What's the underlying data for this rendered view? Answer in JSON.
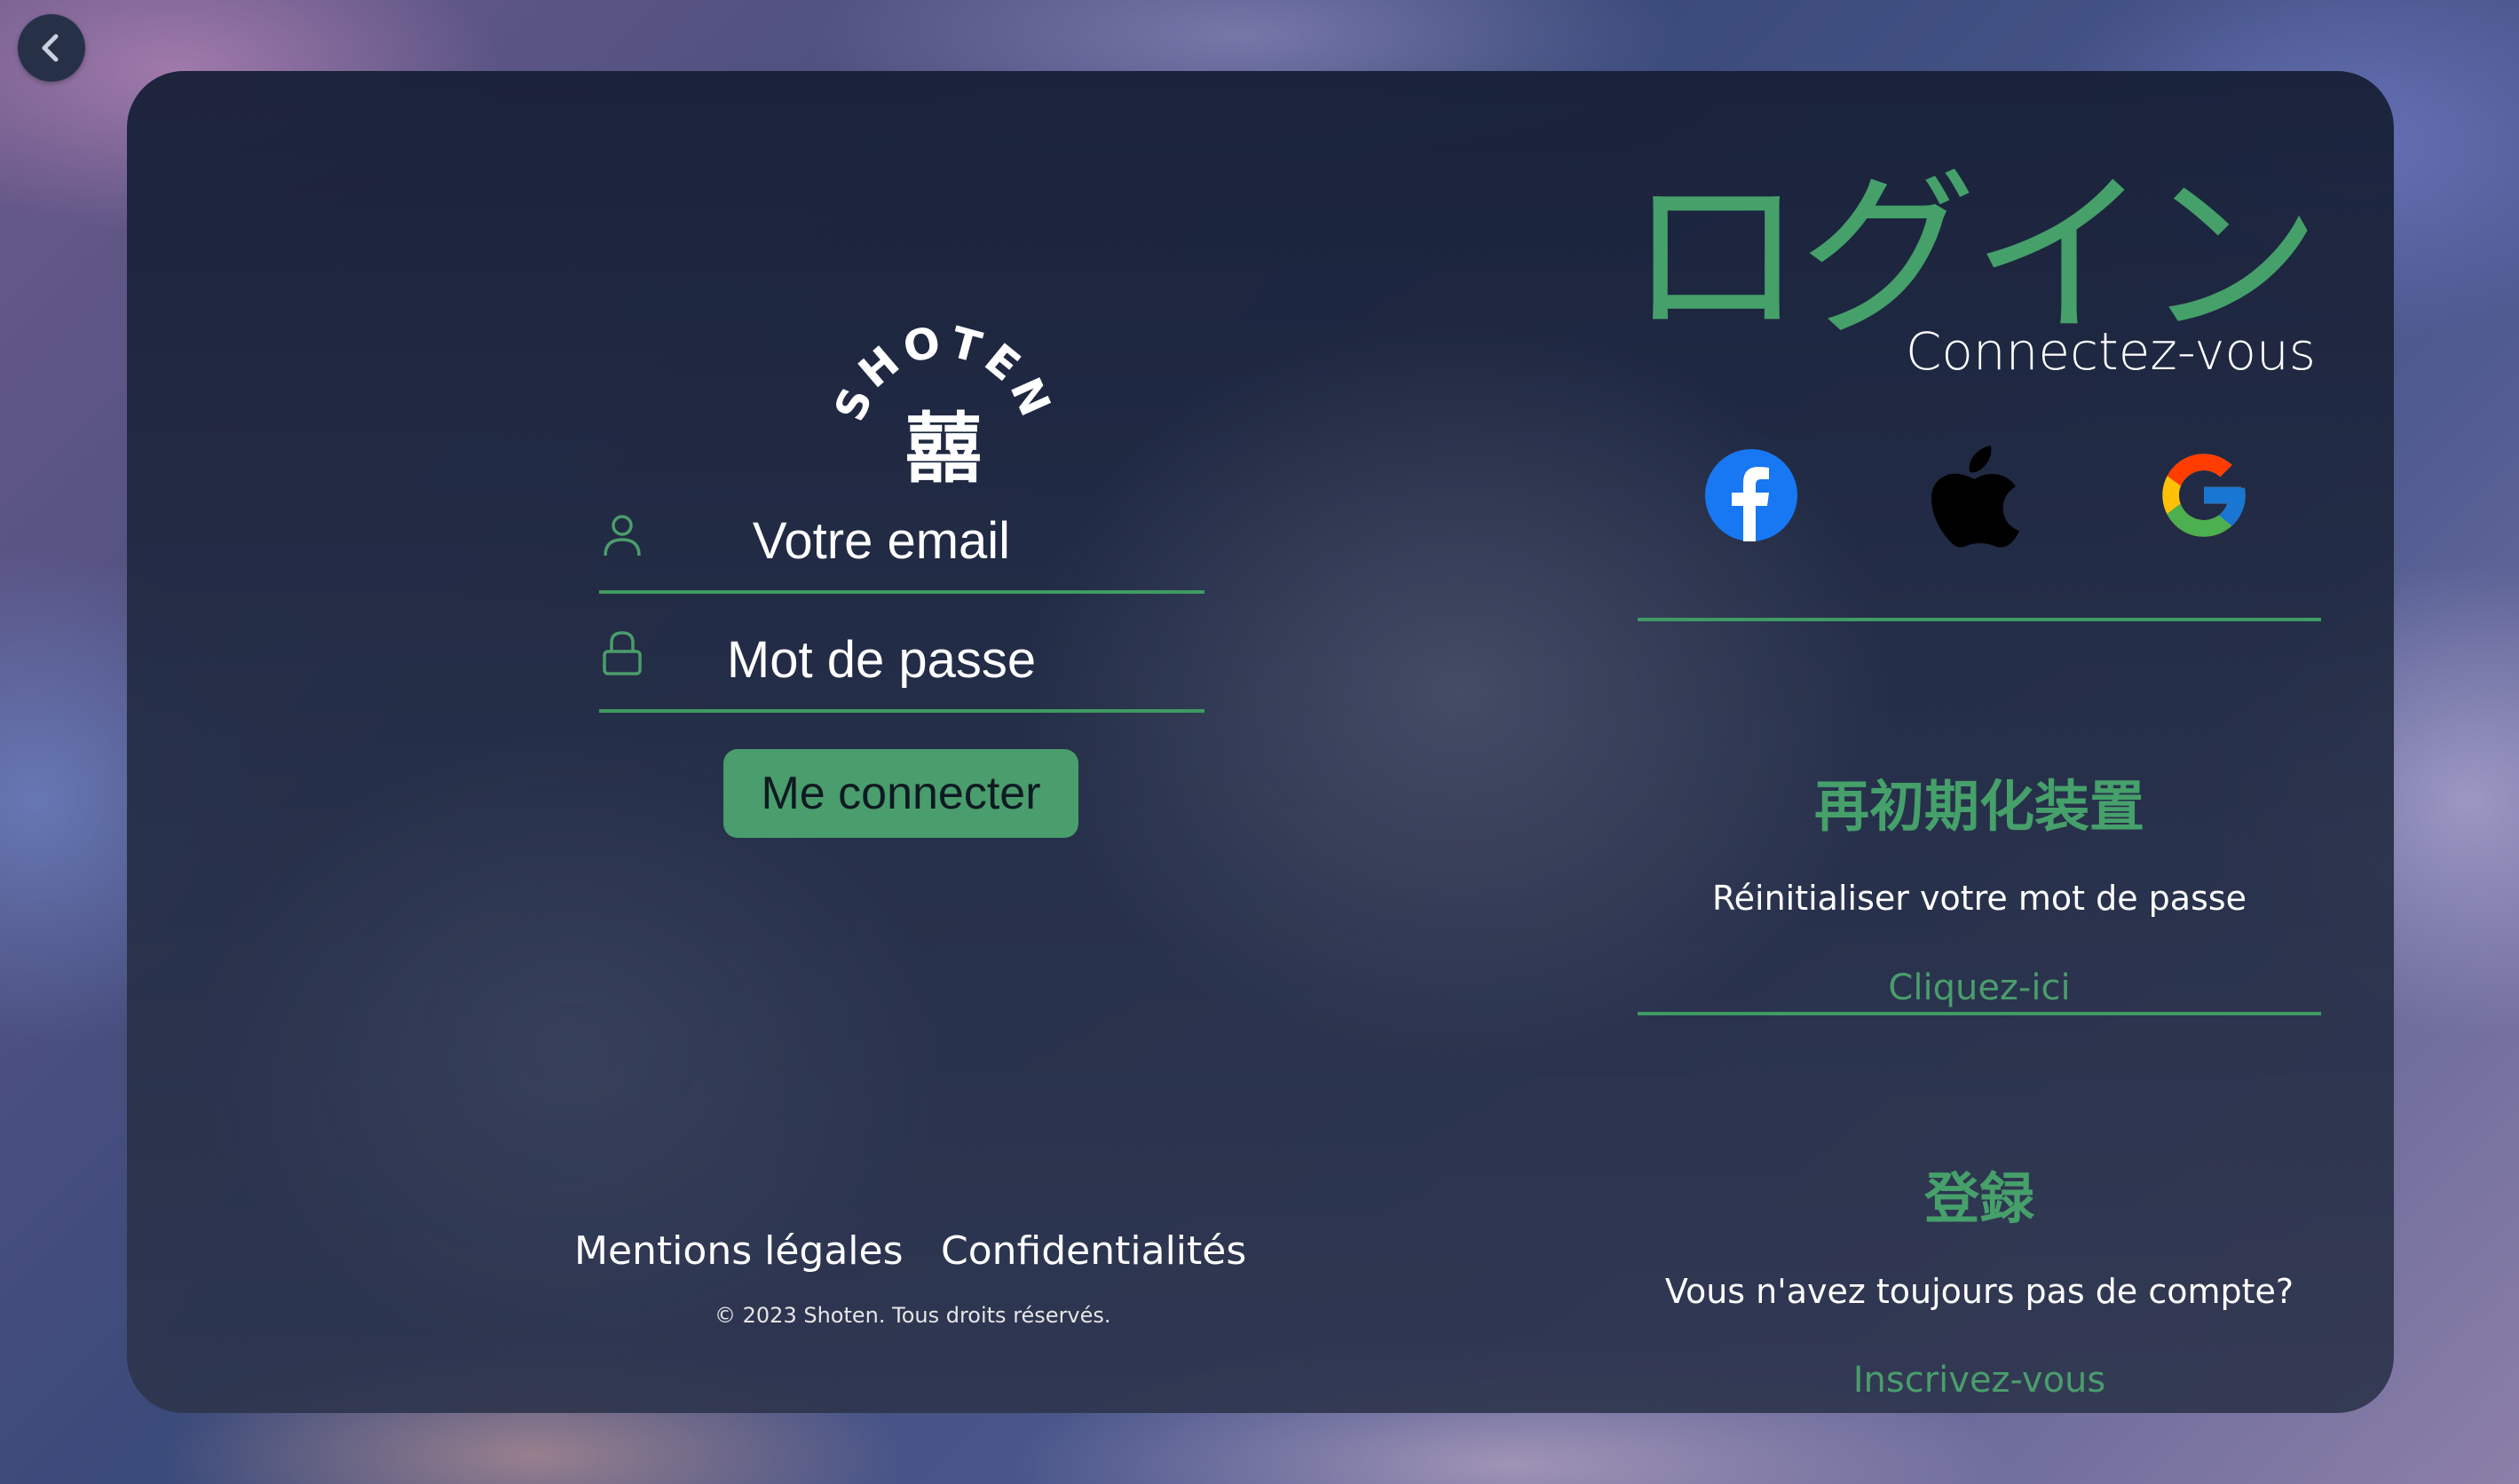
{
  "logo": {
    "brand_text": "SHOTEN",
    "kanji": "囍"
  },
  "login_form": {
    "email_placeholder": "Votre email",
    "password_placeholder": "Mot de passe",
    "submit_label": "Me connecter"
  },
  "footer": {
    "legal_label": "Mentions légales",
    "privacy_label": "Confidentialités",
    "copyright": "© 2023 Shoten. Tous droits réservés."
  },
  "header": {
    "title_jp": "ログイン",
    "subtitle": "Connectez-vous"
  },
  "social_icons": [
    "facebook-icon",
    "apple-icon",
    "google-icon"
  ],
  "reset": {
    "title_jp": "再初期化装置",
    "text": "Réinitialiser votre mot de passe",
    "link": "Cliquez-ici"
  },
  "register": {
    "title_jp": "登録",
    "text": "Vous n'avez toujours pas de compte?",
    "link": "Inscrivez-vous"
  },
  "colors": {
    "accent": "#4a9d6c",
    "card": "#1c2540",
    "facebook": "#1877f2"
  }
}
